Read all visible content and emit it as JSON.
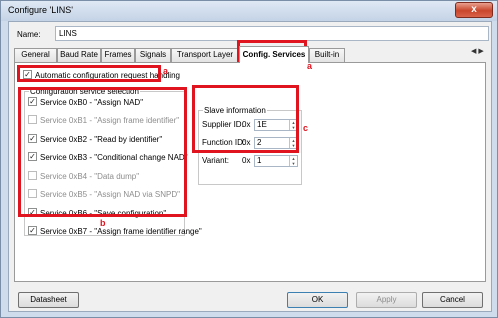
{
  "window": {
    "title": "Configure 'LINS'",
    "close_glyph": "x"
  },
  "name": {
    "label": "Name:",
    "value": "LINS"
  },
  "tabs": [
    {
      "label": "General"
    },
    {
      "label": "Baud Rate"
    },
    {
      "label": "Frames"
    },
    {
      "label": "Signals"
    },
    {
      "label": "Transport Layer"
    },
    {
      "label": "Config. Services"
    },
    {
      "label": "Built-in"
    }
  ],
  "tab_arrows": "◀ ▶",
  "auto_config": {
    "label": "Automatic configuration request handling",
    "checked": true
  },
  "service_group": {
    "title": "Configuration service selection",
    "items": [
      {
        "label": "Service 0xB0 - \"Assign NAD\"",
        "checked": true,
        "enabled": true
      },
      {
        "label": "Service 0xB1 - \"Assign frame identifier\"",
        "checked": false,
        "enabled": false
      },
      {
        "label": "Service 0xB2 - \"Read by identifier\"",
        "checked": true,
        "enabled": true
      },
      {
        "label": "Service 0xB3 - \"Conditional change NAD\"",
        "checked": true,
        "enabled": true
      },
      {
        "label": "Service 0xB4 - \"Data dump\"",
        "checked": false,
        "enabled": false
      },
      {
        "label": "Service 0xB5 - \"Assign NAD via SNPD\"",
        "checked": false,
        "enabled": false
      },
      {
        "label": "Service 0xB6 - \"Save configuration\"",
        "checked": true,
        "enabled": true
      },
      {
        "label": "Service 0xB7 - \"Assign frame identifier range\"",
        "checked": true,
        "enabled": true
      }
    ]
  },
  "slave_group": {
    "title": "Slave information",
    "fields": [
      {
        "label": "Supplier ID:",
        "prefix": "0x",
        "value": "1E"
      },
      {
        "label": "Function ID:",
        "prefix": "0x",
        "value": "2"
      },
      {
        "label": "Variant:",
        "prefix": "0x",
        "value": "1"
      }
    ]
  },
  "annotations": {
    "a1": "a",
    "a2": "a",
    "b": "b",
    "c": "c"
  },
  "buttons": {
    "datasheet": "Datasheet",
    "ok": "OK",
    "apply": "Apply",
    "cancel": "Cancel"
  },
  "colors": {
    "highlight": "#e0141f",
    "frame": "#cfdcec"
  }
}
